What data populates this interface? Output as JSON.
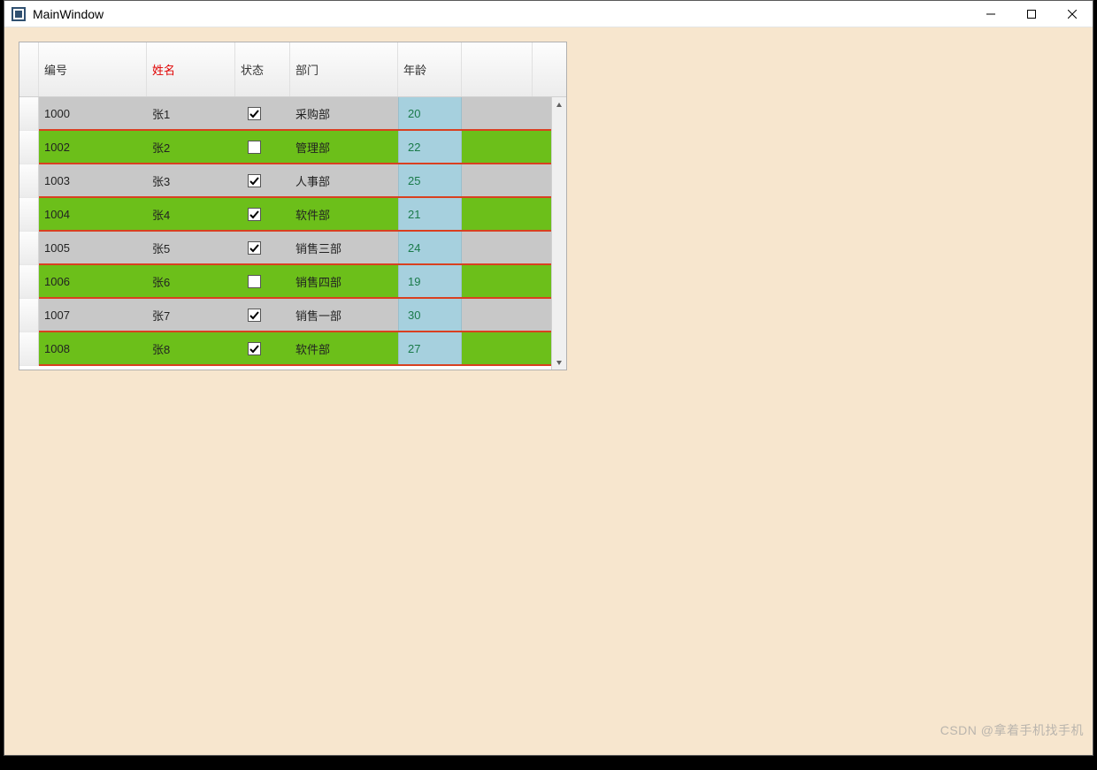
{
  "window": {
    "title": "MainWindow"
  },
  "colors": {
    "client_bg": "#f7e6ce",
    "row_alt_a": "#c8c8c8",
    "row_alt_b": "#6cbf1a",
    "row_divider": "#d94020",
    "age_bg": "#a6d0de",
    "age_fg": "#1a7a4a",
    "header_name_fg": "#e00000"
  },
  "table": {
    "headers": {
      "id": "编号",
      "name": "姓名",
      "status": "状态",
      "dept": "部门",
      "age": "年龄",
      "extra": ""
    },
    "rows": [
      {
        "id": "1000",
        "name": "张1",
        "status": true,
        "dept": "采购部",
        "age": "20"
      },
      {
        "id": "1002",
        "name": "张2",
        "status": false,
        "dept": "管理部",
        "age": "22"
      },
      {
        "id": "1003",
        "name": "张3",
        "status": true,
        "dept": "人事部",
        "age": "25"
      },
      {
        "id": "1004",
        "name": "张4",
        "status": true,
        "dept": "软件部",
        "age": "21"
      },
      {
        "id": "1005",
        "name": "张5",
        "status": true,
        "dept": "销售三部",
        "age": "24"
      },
      {
        "id": "1006",
        "name": "张6",
        "status": false,
        "dept": "销售四部",
        "age": "19"
      },
      {
        "id": "1007",
        "name": "张7",
        "status": true,
        "dept": "销售一部",
        "age": "30"
      },
      {
        "id": "1008",
        "name": "张8",
        "status": true,
        "dept": "软件部",
        "age": "27"
      }
    ]
  },
  "watermark": "CSDN @拿着手机找手机"
}
